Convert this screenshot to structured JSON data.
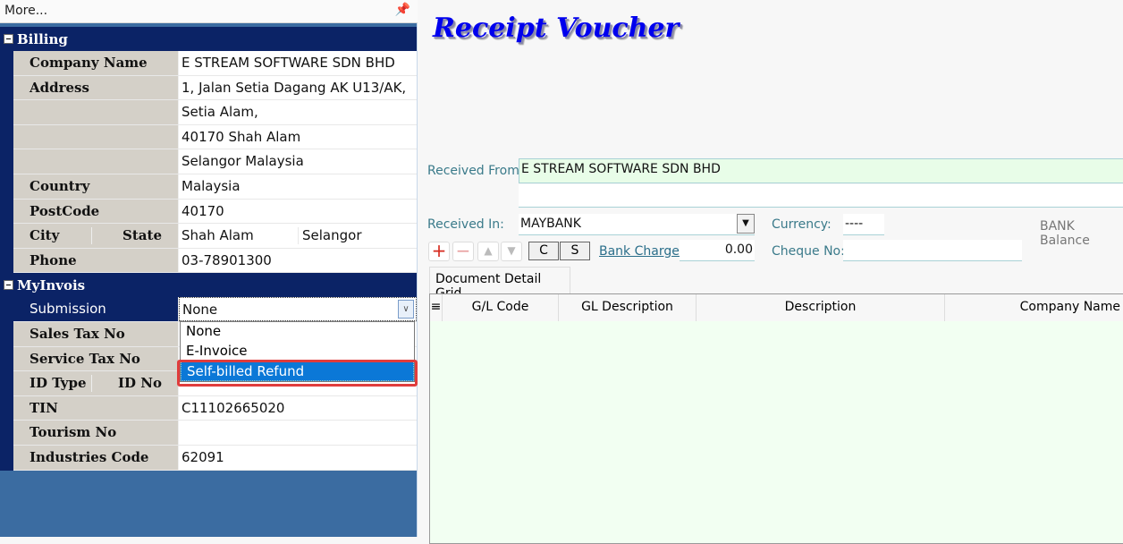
{
  "left_panel": {
    "more_label": "More...",
    "billing": {
      "title": "Billing",
      "company_name": {
        "label": "Company Name",
        "value": "E STREAM SOFTWARE SDN BHD"
      },
      "address": {
        "label": "Address",
        "lines": [
          "1, Jalan Setia Dagang AK U13/AK,",
          "Setia Alam,",
          "40170 Shah Alam",
          "Selangor Malaysia"
        ]
      },
      "country": {
        "label": "Country",
        "value": "Malaysia"
      },
      "postcode": {
        "label": "PostCode",
        "value": "40170"
      },
      "city": {
        "label": "City",
        "value": "Shah Alam"
      },
      "state": {
        "label": "State",
        "value": "Selangor"
      },
      "phone": {
        "label": "Phone",
        "value": "03-78901300"
      }
    },
    "myinvois": {
      "title": "MyInvois",
      "submission": {
        "label": "Submission",
        "value": "None",
        "options": [
          "None",
          "E-Invoice",
          "Self-billed Refund"
        ],
        "highlighted": "Self-billed Refund"
      },
      "sales_tax": {
        "label": "Sales Tax No"
      },
      "service_tax": {
        "label": "Service Tax No"
      },
      "id_type": {
        "label": "ID Type"
      },
      "id_no": {
        "label": "ID No"
      },
      "tin": {
        "label": "TIN",
        "value": "C11102665020"
      },
      "tourism": {
        "label": "Tourism No",
        "value": ""
      },
      "industries": {
        "label": "Industries Code",
        "value": "62091"
      }
    }
  },
  "voucher": {
    "title": "Receipt Voucher",
    "received_from": {
      "label": "Received From:",
      "value": "E STREAM SOFTWARE SDN BHD"
    },
    "received_in": {
      "label": "Received In:",
      "value": "MAYBANK"
    },
    "currency": {
      "label": "Currency:",
      "value": "----"
    },
    "bank_balance_label": "BANK Balance",
    "bank_charge": {
      "label": "Bank Charge:",
      "value": "0.00"
    },
    "cheque_no": {
      "label": "Cheque No:",
      "value": ""
    },
    "buttons": {
      "c": "C",
      "s": "S"
    },
    "tab_label": "Document Detail Grid",
    "grid_columns": [
      "G/L Code",
      "GL Description",
      "Description",
      "Company Name"
    ]
  }
}
